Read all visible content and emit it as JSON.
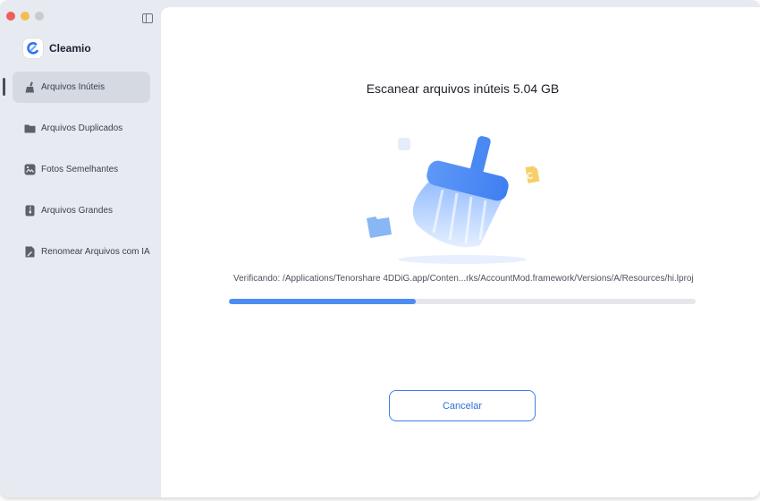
{
  "colors": {
    "close": "#ee5e57",
    "minimize": "#f4bd4f",
    "maximize": "#c9cbd1",
    "accent": "#4d8df3",
    "sidebar_bg": "#e7eaf1"
  },
  "window": {
    "buttons": [
      "close",
      "minimize",
      "maximize"
    ]
  },
  "sidebar": {
    "brand": {
      "name": "Cleamio",
      "icon": "cleamio-logo-icon"
    },
    "items": [
      {
        "label": "Arquivos Inúteis",
        "icon": "broom-icon",
        "active": true
      },
      {
        "label": "Arquivos Duplicados",
        "icon": "folder-icon",
        "active": false
      },
      {
        "label": "Fotos Semelhantes",
        "icon": "photo-icon",
        "active": false
      },
      {
        "label": "Arquivos Grandes",
        "icon": "zip-file-icon",
        "active": false
      },
      {
        "label": "Renomear Arquivos com IA",
        "icon": "ai-file-icon",
        "active": false
      }
    ]
  },
  "main": {
    "title": "Escanear arquivos inúteis",
    "size": "5.04 GB",
    "path": "Verificando: /Applications/Tenorshare 4DDiG.app/Conten...rks/AccountMod.framework/Versions/A/Resources/hi.lproj",
    "progress_fraction": 0.4,
    "cancel_label": "Cancelar"
  }
}
